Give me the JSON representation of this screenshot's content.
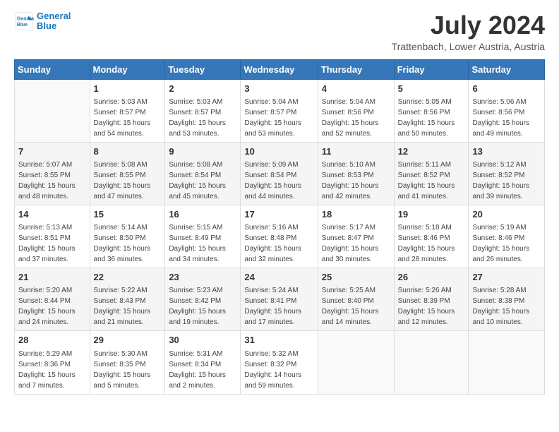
{
  "logo": {
    "line1": "General",
    "line2": "Blue"
  },
  "title": "July 2024",
  "location": "Trattenbach, Lower Austria, Austria",
  "weekdays": [
    "Sunday",
    "Monday",
    "Tuesday",
    "Wednesday",
    "Thursday",
    "Friday",
    "Saturday"
  ],
  "weeks": [
    [
      {
        "day": "",
        "empty": true
      },
      {
        "day": "1",
        "sunrise": "5:03 AM",
        "sunset": "8:57 PM",
        "daylight": "15 hours and 54 minutes."
      },
      {
        "day": "2",
        "sunrise": "5:03 AM",
        "sunset": "8:57 PM",
        "daylight": "15 hours and 53 minutes."
      },
      {
        "day": "3",
        "sunrise": "5:04 AM",
        "sunset": "8:57 PM",
        "daylight": "15 hours and 53 minutes."
      },
      {
        "day": "4",
        "sunrise": "5:04 AM",
        "sunset": "8:56 PM",
        "daylight": "15 hours and 52 minutes."
      },
      {
        "day": "5",
        "sunrise": "5:05 AM",
        "sunset": "8:56 PM",
        "daylight": "15 hours and 50 minutes."
      },
      {
        "day": "6",
        "sunrise": "5:06 AM",
        "sunset": "8:56 PM",
        "daylight": "15 hours and 49 minutes."
      }
    ],
    [
      {
        "day": "7",
        "sunrise": "5:07 AM",
        "sunset": "8:55 PM",
        "daylight": "15 hours and 48 minutes."
      },
      {
        "day": "8",
        "sunrise": "5:08 AM",
        "sunset": "8:55 PM",
        "daylight": "15 hours and 47 minutes."
      },
      {
        "day": "9",
        "sunrise": "5:08 AM",
        "sunset": "8:54 PM",
        "daylight": "15 hours and 45 minutes."
      },
      {
        "day": "10",
        "sunrise": "5:09 AM",
        "sunset": "8:54 PM",
        "daylight": "15 hours and 44 minutes."
      },
      {
        "day": "11",
        "sunrise": "5:10 AM",
        "sunset": "8:53 PM",
        "daylight": "15 hours and 42 minutes."
      },
      {
        "day": "12",
        "sunrise": "5:11 AM",
        "sunset": "8:52 PM",
        "daylight": "15 hours and 41 minutes."
      },
      {
        "day": "13",
        "sunrise": "5:12 AM",
        "sunset": "8:52 PM",
        "daylight": "15 hours and 39 minutes."
      }
    ],
    [
      {
        "day": "14",
        "sunrise": "5:13 AM",
        "sunset": "8:51 PM",
        "daylight": "15 hours and 37 minutes."
      },
      {
        "day": "15",
        "sunrise": "5:14 AM",
        "sunset": "8:50 PM",
        "daylight": "15 hours and 36 minutes."
      },
      {
        "day": "16",
        "sunrise": "5:15 AM",
        "sunset": "8:49 PM",
        "daylight": "15 hours and 34 minutes."
      },
      {
        "day": "17",
        "sunrise": "5:16 AM",
        "sunset": "8:48 PM",
        "daylight": "15 hours and 32 minutes."
      },
      {
        "day": "18",
        "sunrise": "5:17 AM",
        "sunset": "8:47 PM",
        "daylight": "15 hours and 30 minutes."
      },
      {
        "day": "19",
        "sunrise": "5:18 AM",
        "sunset": "8:46 PM",
        "daylight": "15 hours and 28 minutes."
      },
      {
        "day": "20",
        "sunrise": "5:19 AM",
        "sunset": "8:46 PM",
        "daylight": "15 hours and 26 minutes."
      }
    ],
    [
      {
        "day": "21",
        "sunrise": "5:20 AM",
        "sunset": "8:44 PM",
        "daylight": "15 hours and 24 minutes."
      },
      {
        "day": "22",
        "sunrise": "5:22 AM",
        "sunset": "8:43 PM",
        "daylight": "15 hours and 21 minutes."
      },
      {
        "day": "23",
        "sunrise": "5:23 AM",
        "sunset": "8:42 PM",
        "daylight": "15 hours and 19 minutes."
      },
      {
        "day": "24",
        "sunrise": "5:24 AM",
        "sunset": "8:41 PM",
        "daylight": "15 hours and 17 minutes."
      },
      {
        "day": "25",
        "sunrise": "5:25 AM",
        "sunset": "8:40 PM",
        "daylight": "15 hours and 14 minutes."
      },
      {
        "day": "26",
        "sunrise": "5:26 AM",
        "sunset": "8:39 PM",
        "daylight": "15 hours and 12 minutes."
      },
      {
        "day": "27",
        "sunrise": "5:28 AM",
        "sunset": "8:38 PM",
        "daylight": "15 hours and 10 minutes."
      }
    ],
    [
      {
        "day": "28",
        "sunrise": "5:29 AM",
        "sunset": "8:36 PM",
        "daylight": "15 hours and 7 minutes."
      },
      {
        "day": "29",
        "sunrise": "5:30 AM",
        "sunset": "8:35 PM",
        "daylight": "15 hours and 5 minutes."
      },
      {
        "day": "30",
        "sunrise": "5:31 AM",
        "sunset": "8:34 PM",
        "daylight": "15 hours and 2 minutes."
      },
      {
        "day": "31",
        "sunrise": "5:32 AM",
        "sunset": "8:32 PM",
        "daylight": "14 hours and 59 minutes."
      },
      {
        "day": "",
        "empty": true
      },
      {
        "day": "",
        "empty": true
      },
      {
        "day": "",
        "empty": true
      }
    ]
  ],
  "labels": {
    "sunrise": "Sunrise:",
    "sunset": "Sunset:",
    "daylight": "Daylight:"
  }
}
